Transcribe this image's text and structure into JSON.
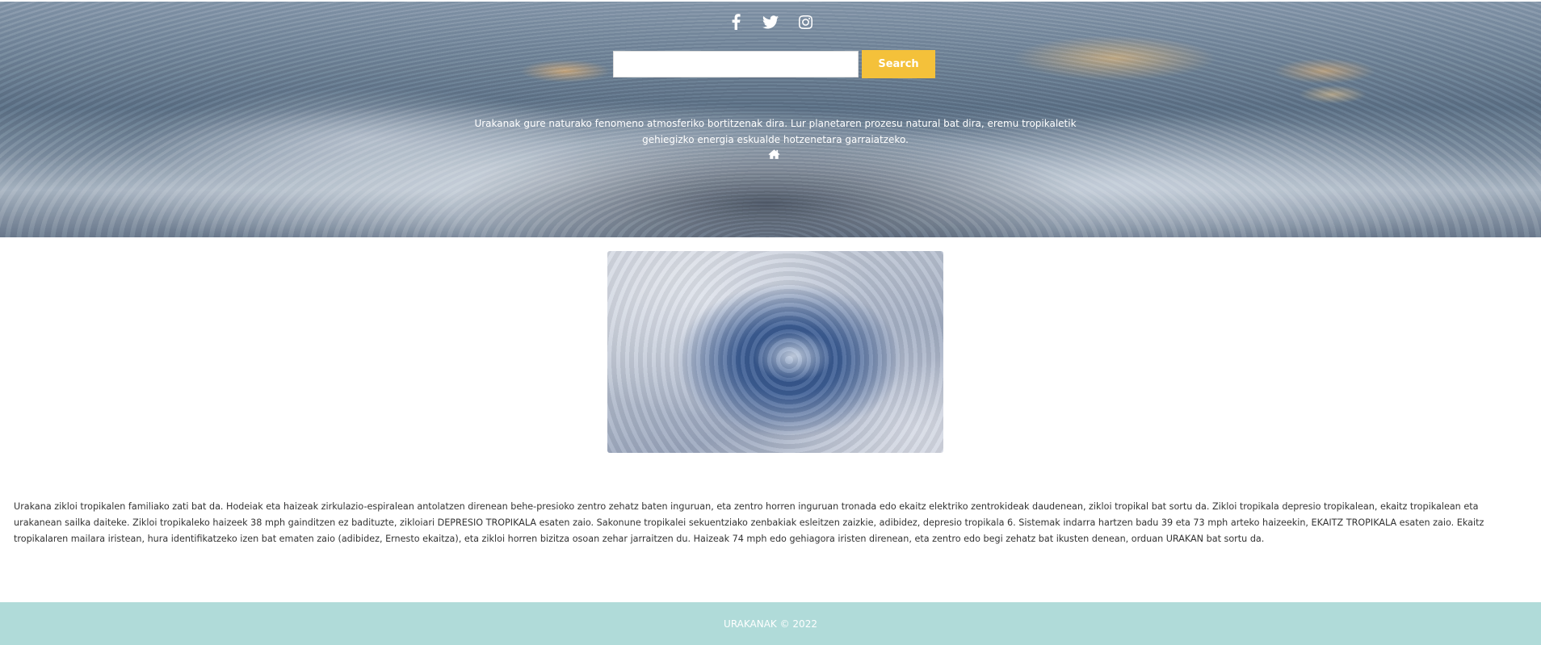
{
  "social": {
    "icons": [
      "facebook-icon",
      "twitter-icon",
      "instagram-icon"
    ]
  },
  "search": {
    "input_value": "",
    "placeholder": "",
    "button_label": "Search"
  },
  "hero": {
    "intro_text": "Urakanak gure naturako fenomeno atmosferiko bortitzenak dira. Lur planetaren prozesu natural bat dira, eremu tropikaletik gehiegizko energia eskualde hotzenetara garraiatzeko.",
    "home_icon": "home-icon"
  },
  "main": {
    "body_text": "Urakana zikloi tropikalen familiako zati bat da. Hodeiak eta haizeak zirkulazio-espiralean antolatzen direnean behe-presioko zentro zehatz baten inguruan, eta zentro horren inguruan tronada edo ekaitz elektriko zentrokideak daudenean, zikloi tropikal bat sortu da. Zikloi tropikala depresio tropikalean, ekaitz tropikalean eta urakanean sailka daiteke. Zikloi tropikaleko haizeek 38 mph gainditzen ez badituzte, zikloiari DEPRESIO TROPIKALA esaten zaio. Sakonune tropikalei sekuentziako zenbakiak esleitzen zaizkie, adibidez, depresio tropikala 6. Sistemak indarra hartzen badu 39 eta 73 mph arteko haizeekin, EKAITZ TROPIKALA esaten zaio. Ekaitz tropikalaren mailara iristean, hura identifikatzeko izen bat ematen zaio (adibidez, Ernesto ekaitza), eta zikloi horren bizitza osoan zehar jarraitzen du. Haizeak 74 mph edo gehiagora iristen direnean, eta zentro edo begi zehatz bat ikusten denean, orduan URAKAN bat sortu da."
  },
  "footer": {
    "text": "URAKANAK © 2022"
  },
  "colors": {
    "search_button": "#f4c13a",
    "footer_bg": "#b0dbd9"
  }
}
